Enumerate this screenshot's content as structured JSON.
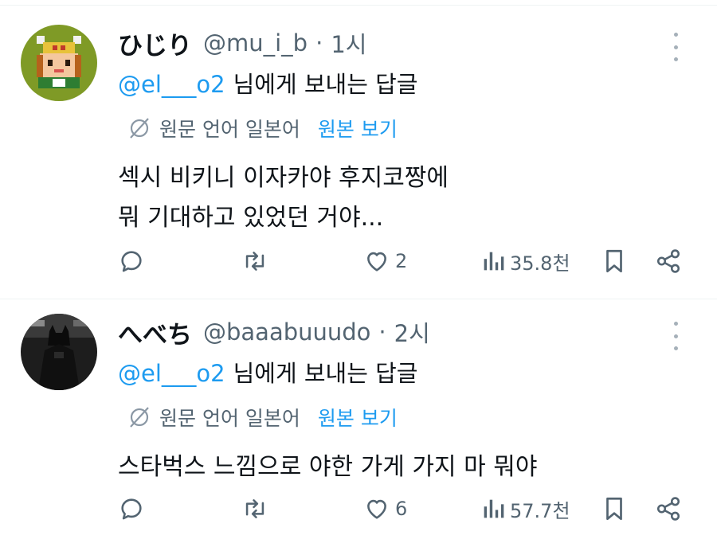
{
  "tweets": [
    {
      "name": "ひじり",
      "handle": "@mu_i_b",
      "separator": "·",
      "time": "1시",
      "mention": "@el___o2",
      "reply_suffix": "님에게 보내는 답글",
      "translate_label": "원문 언어 일본어",
      "translate_link": "원본 보기",
      "text_lines": [
        "섹시 비키니 이자카야 후지코짱에",
        "뭐 기대하고 있었던 거야..."
      ],
      "likes": "2",
      "views": "35.8천"
    },
    {
      "name": "へべち",
      "handle": "@baaabuuudo",
      "separator": "·",
      "time": "2시",
      "mention": "@el___o2",
      "reply_suffix": "님에게 보내는 답글",
      "translate_label": "원문 언어 일본어",
      "translate_link": "원본 보기",
      "text_lines": [
        "스타벅스 느낌으로 야한 가게 가지 마 뭐야"
      ],
      "likes": "6",
      "views": "57.7천"
    }
  ],
  "icons": {
    "reply": "reply-icon",
    "retweet": "retweet-icon",
    "like": "heart-icon",
    "views": "views-icon",
    "bookmark": "bookmark-icon",
    "share": "share-icon",
    "translate": "translate-globe-icon",
    "more": "more-icon"
  },
  "colors": {
    "accent": "#1d9bf0",
    "secondary_text": "#536471",
    "primary_text": "#0f1419"
  }
}
